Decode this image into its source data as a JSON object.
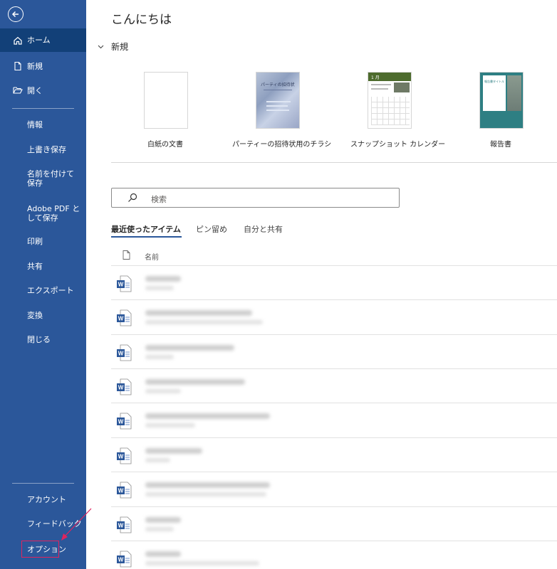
{
  "sidebar": {
    "back_icon": "arrow-left-circle-icon",
    "items": [
      {
        "label": "ホーム",
        "icon": "home-icon",
        "active": true
      },
      {
        "label": "新規",
        "icon": "new-document-icon"
      },
      {
        "label": "開く",
        "icon": "folder-open-icon"
      },
      {
        "label": "情報"
      },
      {
        "label": "上書き保存"
      },
      {
        "label": "名前を付けて保存"
      },
      {
        "label": "Adobe PDF として保存"
      },
      {
        "label": "印刷"
      },
      {
        "label": "共有"
      },
      {
        "label": "エクスポート"
      },
      {
        "label": "変換"
      },
      {
        "label": "閉じる"
      }
    ],
    "bottom_items": [
      {
        "label": "アカウント"
      },
      {
        "label": "フィードバック"
      },
      {
        "label": "オプション"
      }
    ],
    "accent": "#2b579a",
    "active_bg": "#124078"
  },
  "main": {
    "greeting": "こんにちは",
    "new_section": "新規",
    "templates": [
      {
        "label": "白紙の文書"
      },
      {
        "label": "パーティーの招待状用のチラシ",
        "thumb_title": "パーティの招待状"
      },
      {
        "label": "スナップショット カレンダー",
        "thumb_title": "1 月"
      },
      {
        "label": "報告書",
        "thumb_title": "報告書タイトル"
      }
    ],
    "search": {
      "placeholder": "検索"
    },
    "tabs": [
      {
        "label": "最近使ったアイテム",
        "active": true
      },
      {
        "label": "ピン留め"
      },
      {
        "label": "自分と共有"
      }
    ],
    "list_header": "名前"
  },
  "annotation": {
    "highlight_color": "#e0245e"
  }
}
